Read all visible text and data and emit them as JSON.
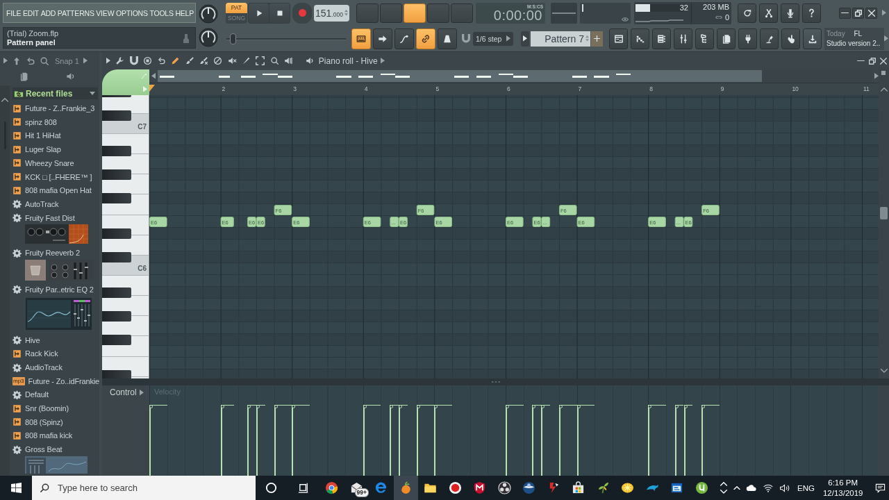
{
  "menu": [
    "FILE",
    "EDIT",
    "ADD",
    "PATTERNS",
    "VIEW",
    "OPTIONS",
    "TOOLS",
    "HELP"
  ],
  "hint_panel": {
    "file": "(Trial) Zoom.flp",
    "hint": "Pattern panel"
  },
  "transport": {
    "modes": [
      {
        "label": "PAT",
        "selected": true
      },
      {
        "label": "SONG",
        "selected": false
      }
    ],
    "tempo": "151",
    "tempo_decimals": ".000"
  },
  "pitch_slider": {
    "level": 0.05
  },
  "mode_buttons": [
    {
      "on": false
    },
    {
      "on": false
    },
    {
      "on": true
    },
    {
      "on": false
    },
    {
      "on": false
    }
  ],
  "time_display": {
    "format": "M:S:CS",
    "value": "0:00:00"
  },
  "cpu_panel": {
    "level": 0.3,
    "polyphony": "32",
    "memory": "203 MB",
    "voices": "0"
  },
  "edit_buttons": [
    {
      "kind": "keyboard",
      "on": true
    },
    {
      "kind": "arrow",
      "on": false
    },
    {
      "kind": "curve",
      "on": false
    },
    {
      "kind": "link",
      "on": true
    },
    {
      "kind": "metronome",
      "on": false
    }
  ],
  "snap": "1/6 step",
  "pattern": "Pattern 7",
  "news": {
    "label": "Today",
    "text": "FL Studio version 2.."
  },
  "browser": {
    "snap": "Snap 1",
    "header": "Recent files",
    "items": [
      {
        "kind": "pattern",
        "label": "Future - Z..Frankie_3"
      },
      {
        "kind": "pattern",
        "label": "spinz 808"
      },
      {
        "kind": "pattern",
        "label": "Hit 1 HiHat"
      },
      {
        "kind": "pattern",
        "label": "Luger Slap"
      },
      {
        "kind": "pattern",
        "label": "Wheezy Snare"
      },
      {
        "kind": "pattern",
        "label": "KCK □ [..FHERE™ ]"
      },
      {
        "kind": "pattern",
        "label": "808 mafia Open Hat"
      },
      {
        "kind": "plugin",
        "label": "AutoTrack"
      },
      {
        "kind": "plugin",
        "label": "Fruity Fast Dist",
        "preview": {
          "kind": "knobs"
        }
      },
      {
        "kind": "plugin",
        "label": "Fruity Reeverb 2",
        "preview": {
          "kind": "reverb"
        }
      },
      {
        "kind": "plugin",
        "label": "Fruity Par..etric EQ 2",
        "preview": {
          "kind": "eq"
        }
      },
      {
        "kind": "plugin",
        "label": "Hive"
      },
      {
        "kind": "pattern",
        "label": "Rack Kick"
      },
      {
        "kind": "plugin",
        "label": "AudioTrack"
      },
      {
        "kind": "audio",
        "badge": "mp3",
        "label": "Future - Zo..idFrankie"
      },
      {
        "kind": "plugin",
        "label": "Default"
      },
      {
        "kind": "pattern",
        "label": "Snr (Boomin)"
      },
      {
        "kind": "pattern",
        "label": "808 (Spinz)"
      },
      {
        "kind": "pattern",
        "label": "808 mafia kick"
      },
      {
        "kind": "plugin",
        "label": "Gross Beat",
        "preview": {
          "kind": "rack"
        }
      }
    ]
  },
  "piano_roll": {
    "title": "Piano roll - Hive",
    "ruler": [
      "2",
      "3",
      "4",
      "5",
      "6",
      "7",
      "8",
      "9",
      "10",
      "11"
    ],
    "key_labels": [
      "C7",
      "C6"
    ],
    "notes": [
      {
        "label": "E6"
      },
      {
        "label": "E6"
      },
      {
        "label": "E6"
      },
      {
        "label": "E6"
      },
      {
        "label": "F6"
      },
      {
        "label": "E6"
      },
      {
        "label": "E6"
      },
      {
        "label": "..."
      },
      {
        "label": "E6"
      },
      {
        "label": "F6"
      },
      {
        "label": "E6"
      },
      {
        "label": "E6"
      },
      {
        "label": "E6"
      },
      {
        "label": "..."
      },
      {
        "label": "F6"
      },
      {
        "label": "E6"
      },
      {
        "label": "E6"
      },
      {
        "label": "..."
      },
      {
        "label": "E6"
      },
      {
        "label": "F6"
      }
    ],
    "control": {
      "label": "Control",
      "parameter": "Velocity"
    }
  },
  "taskbar": {
    "search_placeholder": "Type here to search",
    "apps": [
      {
        "kind": "round-browser",
        "active": false
      },
      {
        "kind": "mail",
        "active": false,
        "badge": "99+"
      },
      {
        "kind": "e-browser",
        "active": false
      },
      {
        "kind": "fruit",
        "active": true
      },
      {
        "kind": "folder",
        "active": false
      },
      {
        "kind": "recorder",
        "active": false
      },
      {
        "kind": "shield",
        "active": false
      },
      {
        "kind": "ring",
        "active": false
      },
      {
        "kind": "globe",
        "active": false
      },
      {
        "kind": "figure",
        "active": false
      },
      {
        "kind": "bag",
        "active": false
      },
      {
        "kind": "plant",
        "active": false
      },
      {
        "kind": "citrus",
        "active": false
      },
      {
        "kind": "dolphin",
        "active": false
      },
      {
        "kind": "window",
        "active": false
      },
      {
        "kind": "round-u",
        "active": false
      }
    ],
    "language": "ENG",
    "time": "6:16 PM",
    "date": "12/13/2019"
  }
}
